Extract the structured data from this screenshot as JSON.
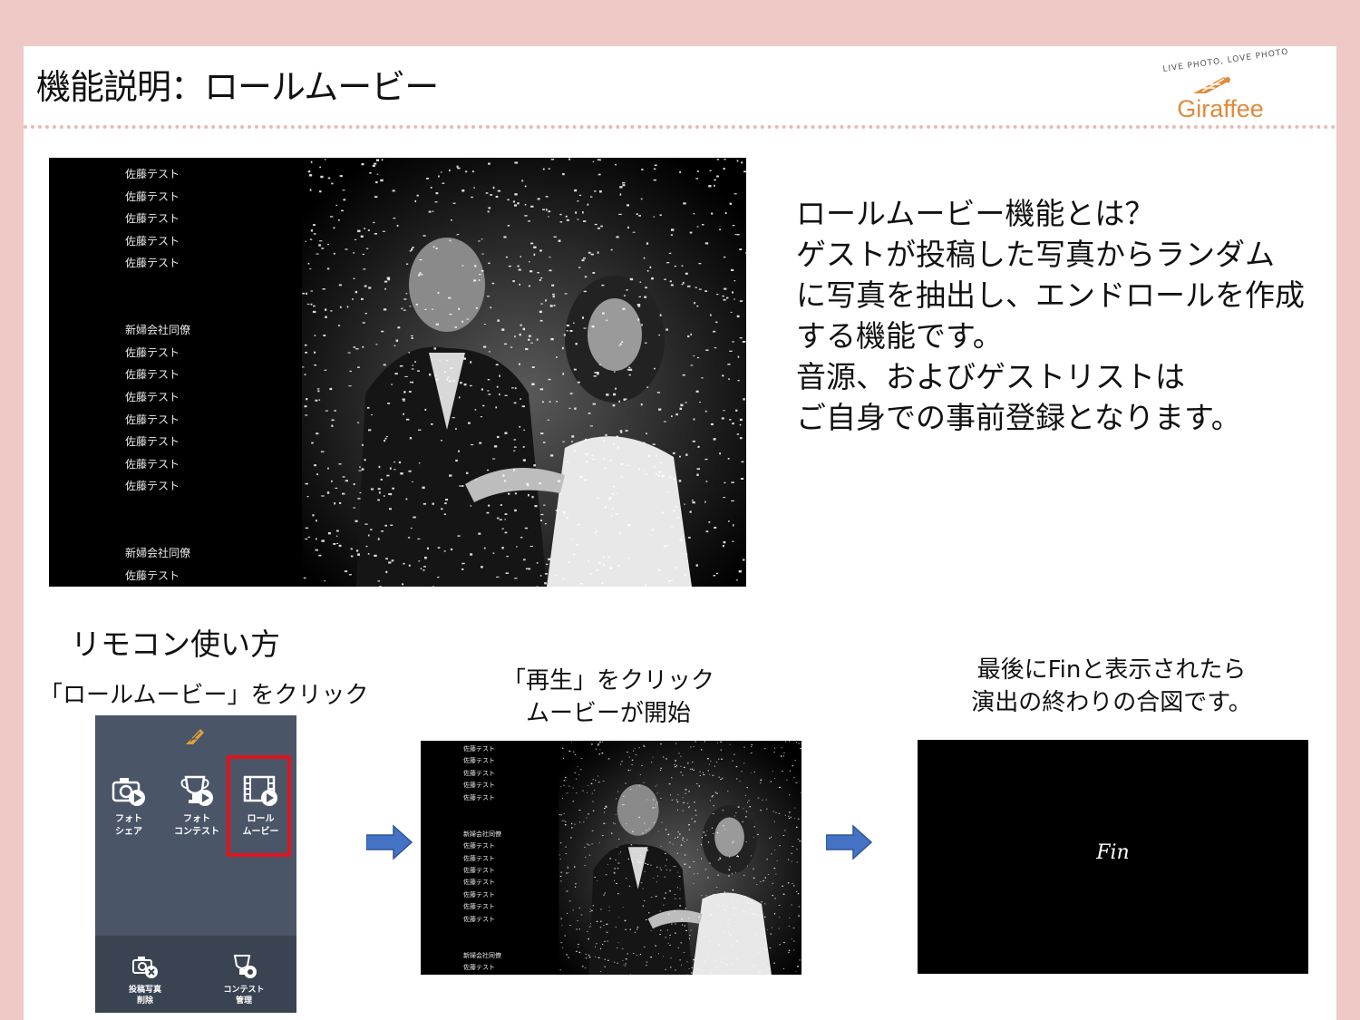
{
  "header": {
    "title": "機能説明：ロールムービー",
    "logo_tagline": "LIVE PHOTO, LOVE PHOTO",
    "logo_text": "Giraffee"
  },
  "credits": {
    "group1": [
      "佐藤テスト",
      "佐藤テスト",
      "佐藤テスト",
      "佐藤テスト",
      "佐藤テスト"
    ],
    "group2_heading": "新婦会社同僚",
    "group2": [
      "佐藤テスト",
      "佐藤テスト",
      "佐藤テスト",
      "佐藤テスト",
      "佐藤テスト",
      "佐藤テスト",
      "佐藤テスト"
    ],
    "group3_heading": "新婦会社同僚",
    "group3": [
      "佐藤テスト"
    ]
  },
  "description": {
    "lines": [
      "ロールムービー機能とは？",
      "ゲストが投稿した写真からランダム",
      "に写真を抽出し、エンドロールを作成",
      "する機能です。",
      "音源、およびゲストリストは",
      "ご自身での事前登録となります。"
    ]
  },
  "remote": {
    "section_title": "リモコン使い方",
    "step1_caption": "「ロールムービー」をクリック",
    "step2_caption_line1": "「再生」をクリック",
    "step2_caption_line2": "ムービーが開始",
    "step3_caption_line1": "最後にFinと表示されたら",
    "step3_caption_line2": "演出の終わりの合図です。",
    "buttons": {
      "photo_share_1": "フォト",
      "photo_share_2": "シェア",
      "photo_contest_1": "フォト",
      "photo_contest_2": "コンテスト",
      "roll_movie_1": "ロール",
      "roll_movie_2": "ムービー",
      "delete_post_1": "投稿写真",
      "delete_post_2": "削除",
      "contest_manage_1": "コンテスト",
      "contest_manage_2": "管理"
    }
  },
  "fin_text": "Fin",
  "colors": {
    "background": "#efc9c5",
    "logo_orange": "#e08a3a",
    "remote_panel": "#4a5568",
    "highlight_red": "#e0141e",
    "arrow_blue": "#4472c4"
  },
  "icons": [
    "camera-play-icon",
    "trophy-play-icon",
    "film-play-icon",
    "camera-delete-icon",
    "trophy-gear-icon",
    "arrow-right-icon"
  ]
}
